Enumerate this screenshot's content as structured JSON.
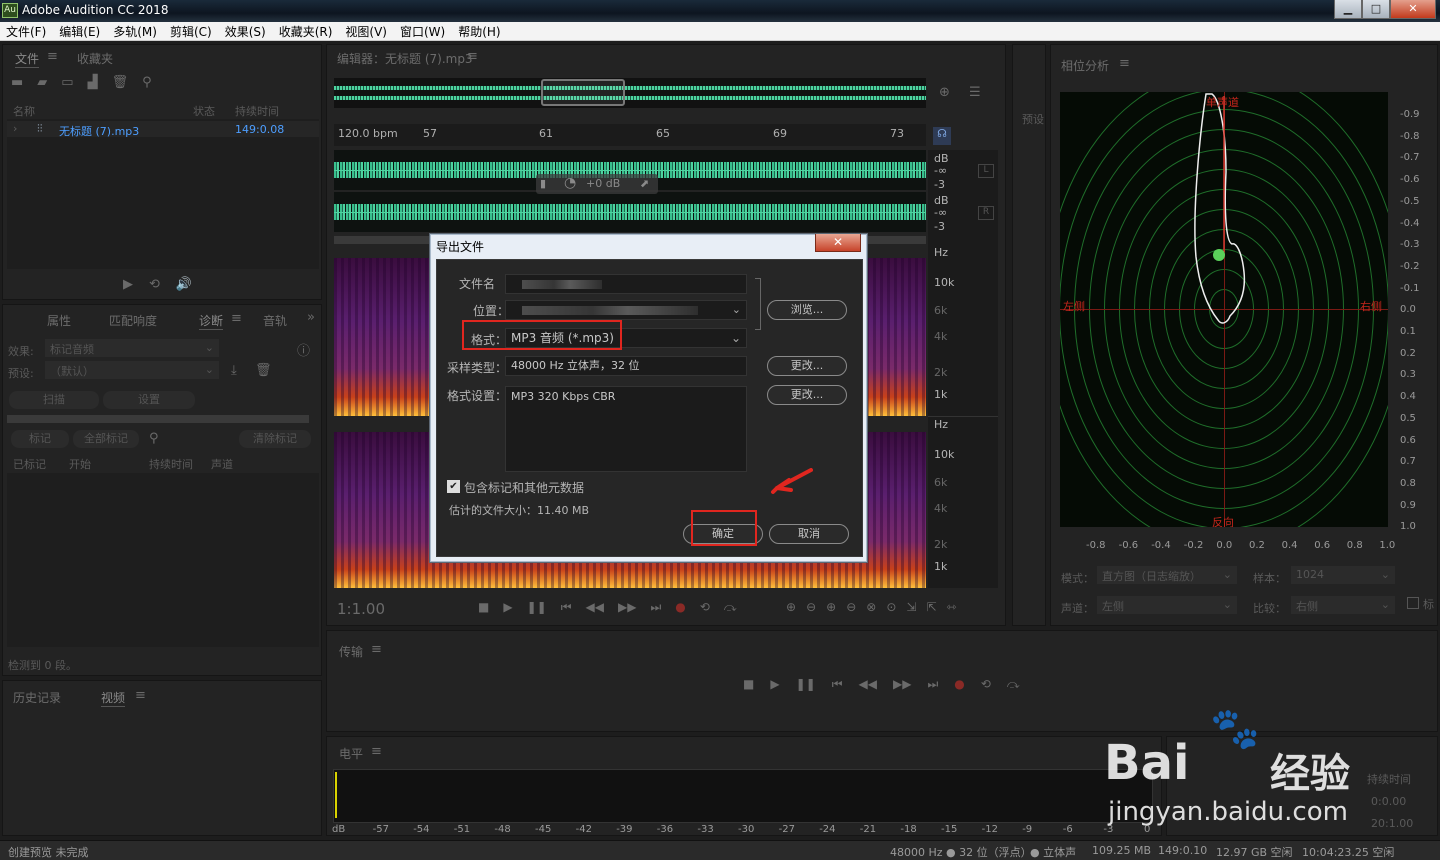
{
  "app": {
    "title": "Adobe Audition CC 2018",
    "icon_text": "Au"
  },
  "window_buttons": {
    "minimize": "▁",
    "maximize": "□",
    "close": "✕"
  },
  "menu": [
    "文件(F)",
    "编辑(E)",
    "多轨(M)",
    "剪辑(C)",
    "效果(S)",
    "收藏夹(R)",
    "视图(V)",
    "窗口(W)",
    "帮助(H)"
  ],
  "files_panel": {
    "tabs": [
      "文件",
      "收藏夹"
    ],
    "columns": [
      "名称",
      "状态",
      "持续时间"
    ],
    "files": [
      {
        "name": "无标题 (7).mp3",
        "duration": "149:0.08"
      }
    ]
  },
  "props_panel": {
    "tabs": [
      "属性",
      "匹配响度",
      "诊断",
      "音轨"
    ],
    "effect_label": "效果:",
    "effect_value": "标记音频",
    "preset_label": "预设:",
    "preset_value": "（默认）",
    "scan_button": "扫描",
    "settings_button": "设置",
    "mark_button": "标记",
    "mark_all_button": "全部标记",
    "clear_button": "清除标记",
    "columns": [
      "已标记",
      "开始",
      "持续时间",
      "声道"
    ],
    "detected": "检测到 0 段。"
  },
  "history_panel": {
    "tabs": [
      "历史记录",
      "视频"
    ]
  },
  "editor": {
    "title": "编辑器：无标题 (7).mp3",
    "bpm": "120.0 bpm",
    "ruler_ticks": [
      "57",
      "61",
      "65",
      "69",
      "73"
    ],
    "db_scale": [
      "dB",
      "-∞",
      "-3"
    ],
    "channel_l": "L",
    "channel_r": "R",
    "hud_gain": "+0 dB",
    "hz_scale": [
      "Hz",
      "10k",
      "6k",
      "4k",
      "2k",
      "1k"
    ],
    "time": "1:1.00"
  },
  "preset_side_label": "预设",
  "dialog": {
    "title": "导出文件",
    "filename_label": "文件名",
    "location_label": "位置：",
    "format_label": "格式：",
    "format_value": "MP3 音频 (*.mp3)",
    "browse_button": "浏览...",
    "sample_label": "采样类型：",
    "sample_value": "48000 Hz 立体声，32 位",
    "change_button_1": "更改...",
    "settings_label": "格式设置：",
    "settings_value": "MP3 320 Kbps CBR",
    "change_button_2": "更改...",
    "checkbox_label": "包含标记和其他元数据",
    "checkbox_checked": true,
    "estimate": "估计的文件大小：11.40 MB",
    "ok_button": "确定",
    "cancel_button": "取消"
  },
  "phase_panel": {
    "title": "相位分析",
    "labels": {
      "top": "单声道",
      "left": "左侧",
      "right": "右侧",
      "bottom": "反向"
    },
    "y_ticks": [
      "-0.9",
      "-0.8",
      "-0.7",
      "-0.6",
      "-0.5",
      "-0.4",
      "-0.3",
      "-0.2",
      "-0.1",
      "0.0",
      "0.1",
      "0.2",
      "0.3",
      "0.4",
      "0.5",
      "0.6",
      "0.7",
      "0.8",
      "0.9",
      "1.0"
    ],
    "x_ticks": [
      "-0.8",
      "-0.6",
      "-0.4",
      "-0.2",
      "0.0",
      "0.2",
      "0.4",
      "0.6",
      "0.8",
      "1.0"
    ],
    "mode_label": "模式：",
    "mode_value": "直方图（日志缩放）",
    "sample_label": "样本：",
    "sample_value": "1024",
    "channel_label": "声道：",
    "channel_value": "左侧",
    "compare_label": "比较：",
    "compare_value": "右侧",
    "checkbox_label": "标"
  },
  "transport_panel": {
    "title": "传输"
  },
  "levels_panel": {
    "title": "电平",
    "scale": [
      "dB",
      "-57",
      "-54",
      "-51",
      "-48",
      "-45",
      "-42",
      "-39",
      "-36",
      "-33",
      "-30",
      "-27",
      "-24",
      "-21",
      "-18",
      "-15",
      "-12",
      "-9",
      "-6",
      "-3",
      "0"
    ]
  },
  "selection_panel": {
    "duration_header": "持续时间",
    "rows": [
      "0:0.00",
      "20:1.00"
    ]
  },
  "watermark": {
    "brand": "Bai",
    "brand2": "经验",
    "url": "jingyan.baidu.com"
  },
  "status": {
    "left": "创建预览 未完成",
    "items": [
      "48000 Hz ● 32 位（浮点）",
      "● 立体声",
      "109.25 MB",
      "149:0.10",
      "12.97 GB 空闲",
      "10:04:23.25 空闲"
    ]
  },
  "colors": {
    "waveform": "#4ed3a0",
    "highlight": "#e0261f",
    "phase_ring": "#1f6e2a"
  }
}
